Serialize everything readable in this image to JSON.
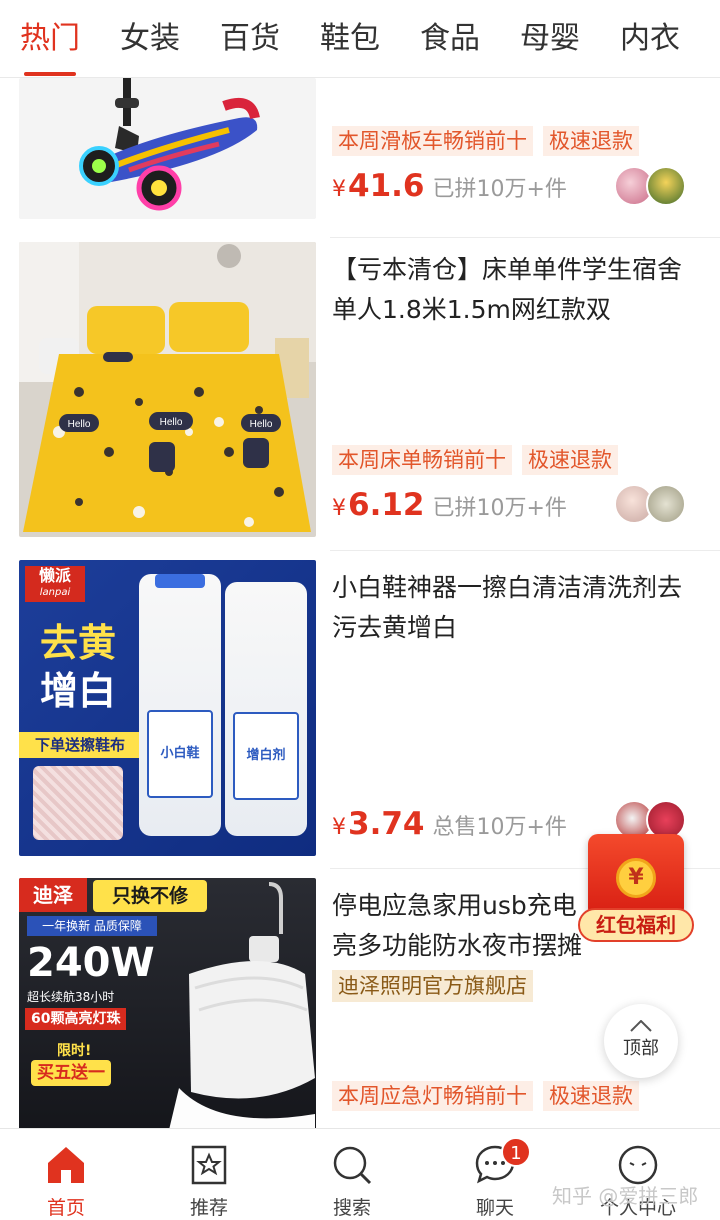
{
  "tabs": [
    "热门",
    "女装",
    "百货",
    "鞋包",
    "食品",
    "母婴",
    "内衣"
  ],
  "products": [
    {
      "title": "",
      "tags": [
        "本周滑板车畅销前十",
        "极速退款"
      ],
      "yen": "¥",
      "price": "41.6",
      "sold": "已拼10万+件"
    },
    {
      "title": "【亏本清仓】床单单件学生宿舍单人1.8米1.5m网红款双",
      "tags": [
        "本周床单畅销前十",
        "极速退款"
      ],
      "yen": "¥",
      "price": "6.12",
      "sold": "已拼10万+件",
      "image_text": "Hello"
    },
    {
      "title": "小白鞋神器一擦白清洁清洗剂去污去黄增白",
      "tags": [],
      "yen": "¥",
      "price": "3.74",
      "sold": "总售10万+件",
      "image_text": {
        "brand": "懒派",
        "brand_en": "lanpai",
        "headline1": "去黄",
        "headline2": "增白",
        "promo": "下单送擦鞋布",
        "bottle1": "小白鞋",
        "bottle2": "增白剂"
      }
    },
    {
      "title": "停电应急家用usb充电亮多功能防水夜市摆摊灯户外",
      "shop": "迪泽照明官方旗舰店",
      "tags": [
        "本周应急灯畅销前十",
        "极速退款"
      ],
      "image_text": {
        "brand": "迪泽",
        "slogan": "只换不修",
        "sub": "一年换新 品质保障",
        "power": "240W",
        "line1": "超长续航38小时",
        "line2": "60颗高亮灯珠",
        "promo1": "限时!",
        "promo2": "买五送一"
      }
    }
  ],
  "red_packet": {
    "label": "红包福利",
    "coin": "¥"
  },
  "back_to_top": "顶部",
  "bottom_nav": [
    {
      "label": "首页",
      "icon": "home-icon"
    },
    {
      "label": "推荐",
      "icon": "star-bookmark-icon"
    },
    {
      "label": "搜索",
      "icon": "search-icon"
    },
    {
      "label": "聊天",
      "icon": "chat-icon",
      "badge": "1"
    },
    {
      "label": "个人中心",
      "icon": "profile-icon"
    }
  ],
  "watermark": "知乎 @爱拼三郎",
  "colors": {
    "accent": "#e0331f",
    "tag_bg": "#fdeee6",
    "tag_text": "#e2562b",
    "shop_bg": "#f7ead4"
  }
}
